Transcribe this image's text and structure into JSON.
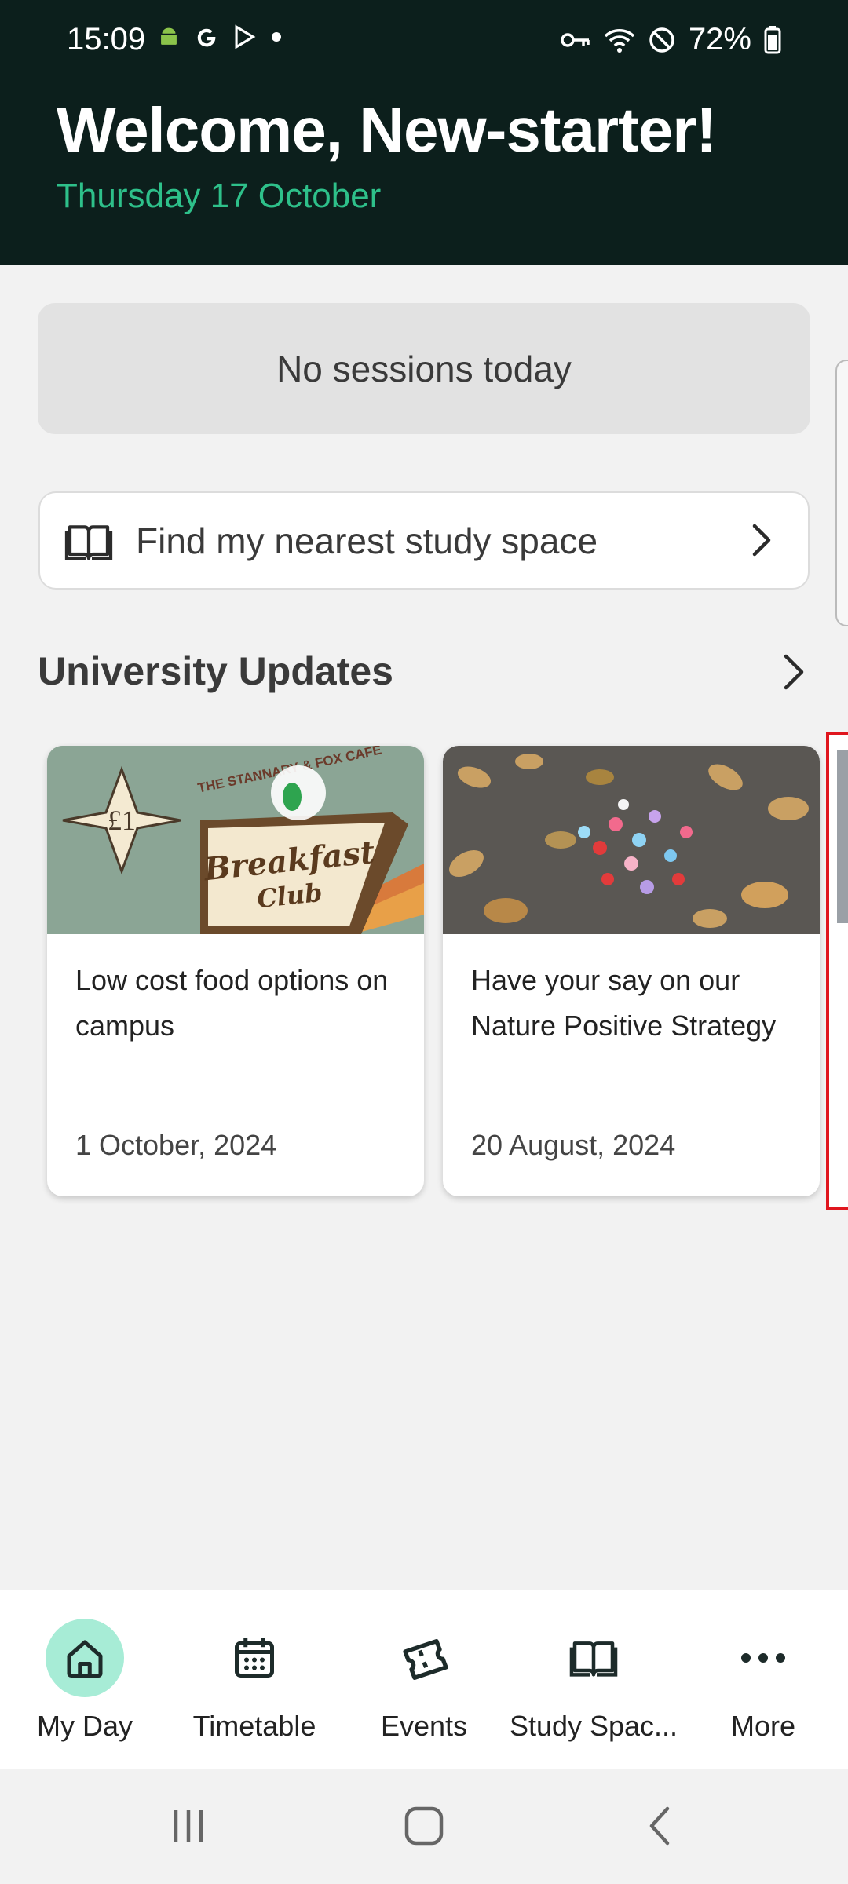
{
  "status_bar": {
    "time": "15:09",
    "battery": "72%"
  },
  "header": {
    "welcome": "Welcome, New-starter!",
    "date": "Thursday 17 October"
  },
  "sessions": {
    "text": "No sessions today"
  },
  "study_space": {
    "icon": "book-icon",
    "label": "Find my nearest study space"
  },
  "updates": {
    "title": "University Updates",
    "cards": [
      {
        "title": "Low cost food options on campus",
        "date": "1 October, 2024",
        "image_price": "£1",
        "image_header": "THE STANNARY & FOX CAFE",
        "image_text_1": "Breakfast",
        "image_text_2": "Club"
      },
      {
        "title": "Have your say on our Nature Positive Strategy",
        "date": "20 August, 2024"
      }
    ]
  },
  "bottom_nav": {
    "items": [
      {
        "label": "My Day",
        "icon": "home-icon",
        "active": true
      },
      {
        "label": "Timetable",
        "icon": "calendar-icon"
      },
      {
        "label": "Events",
        "icon": "ticket-icon"
      },
      {
        "label": "Study Spac...",
        "icon": "book-icon"
      },
      {
        "label": "More",
        "icon": "more-icon"
      }
    ]
  },
  "colors": {
    "header_bg": "#0c1f1c",
    "accent": "#2ec08a",
    "active_nav": "#a7ecd6"
  }
}
